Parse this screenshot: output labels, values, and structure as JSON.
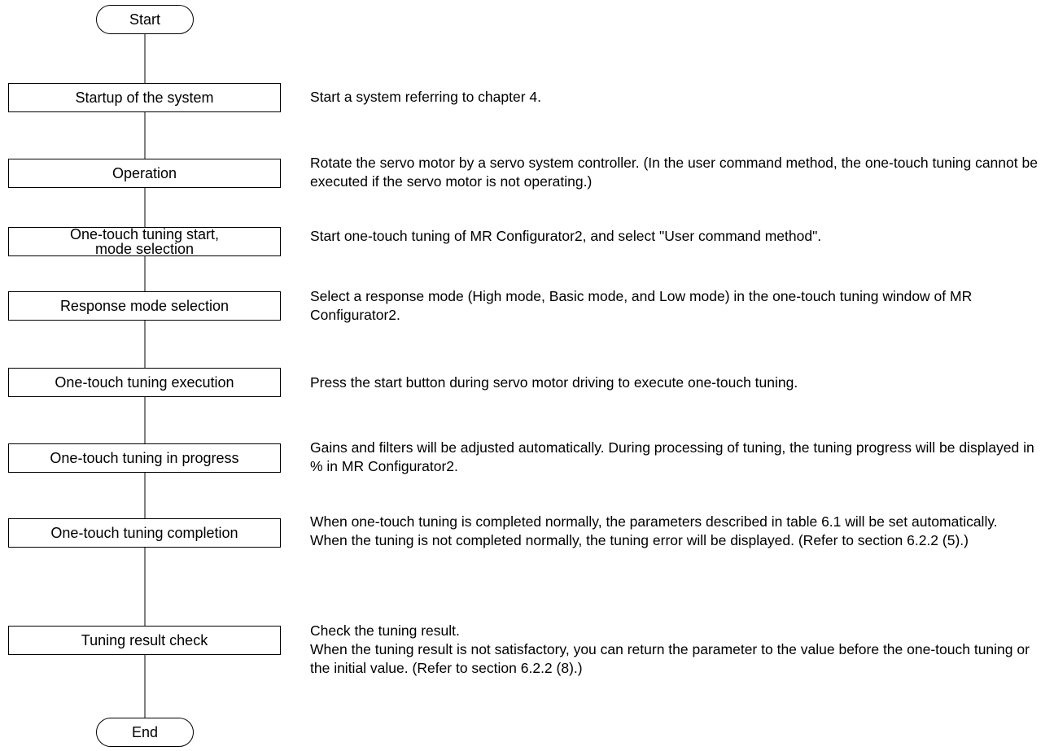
{
  "flowchart": {
    "start_label": "Start",
    "end_label": "End",
    "steps": [
      {
        "label": "Startup of the system",
        "description": [
          "Start a system referring to chapter 4."
        ]
      },
      {
        "label": "Operation",
        "description": [
          "Rotate the servo motor by a servo system controller. (In the user command method, the one-touch tuning cannot be executed if the servo motor is not operating.)"
        ]
      },
      {
        "label": "One-touch tuning start,\nmode selection",
        "description": [
          "Start one-touch tuning of MR Configurator2, and select \"User command method\"."
        ]
      },
      {
        "label": "Response mode selection",
        "description": [
          "Select a response mode (High mode, Basic mode, and Low mode) in the one-touch tuning window of MR Configurator2."
        ]
      },
      {
        "label": "One-touch tuning execution",
        "description": [
          "Press the start button during servo motor driving to execute one-touch tuning."
        ]
      },
      {
        "label": "One-touch tuning in progress",
        "description": [
          "Gains and filters will be adjusted automatically. During processing of tuning, the tuning progress will be displayed in % in MR Configurator2."
        ]
      },
      {
        "label": "One-touch tuning completion",
        "description": [
          "When one-touch tuning is completed normally, the parameters described in table 6.1 will be set automatically.",
          "When the tuning is not completed normally, the tuning error will be displayed. (Refer to section 6.2.2 (5).)"
        ]
      },
      {
        "label": "Tuning result check",
        "description": [
          "Check the tuning result.",
          "When the tuning result is not satisfactory, you can return the parameter to the value before the one-touch tuning or the initial value. (Refer to section 6.2.2 (8).)"
        ]
      }
    ]
  }
}
